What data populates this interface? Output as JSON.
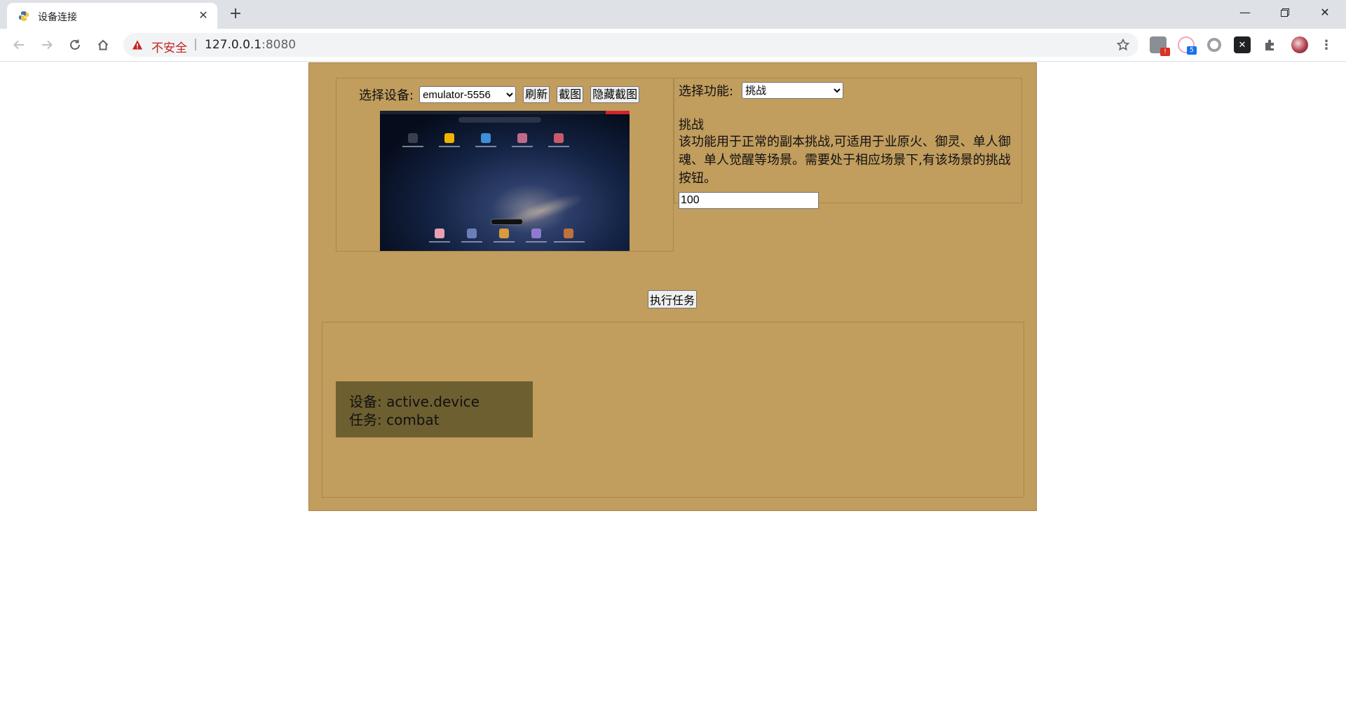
{
  "browser": {
    "tab_title": "设备连接",
    "security_text": "不安全",
    "url_separator": "|",
    "url_host": "127.0.0.1",
    "url_port": ":8080",
    "extension_badges": [
      "!",
      "5"
    ]
  },
  "device": {
    "label": "选择设备:",
    "selected": "emulator-5556",
    "buttons": {
      "refresh": "刷新",
      "screenshot": "截图",
      "hide_screenshot": "隐藏截图"
    }
  },
  "function": {
    "label": "选择功能:",
    "selected": "挑战",
    "name": "挑战",
    "description": "该功能用于正常的副本挑战,可适用于业原火、御灵、单人御魂、单人觉醒等场景。需要处于相应场景下,有该场景的挑战按钮。",
    "count_value": "100"
  },
  "actions": {
    "execute": "执行任务"
  },
  "task": {
    "device_line": "设备: active.device",
    "task_line": "任务: combat"
  },
  "colors": {
    "app_background": "#c19d5e",
    "task_card": "#6d5f30"
  }
}
